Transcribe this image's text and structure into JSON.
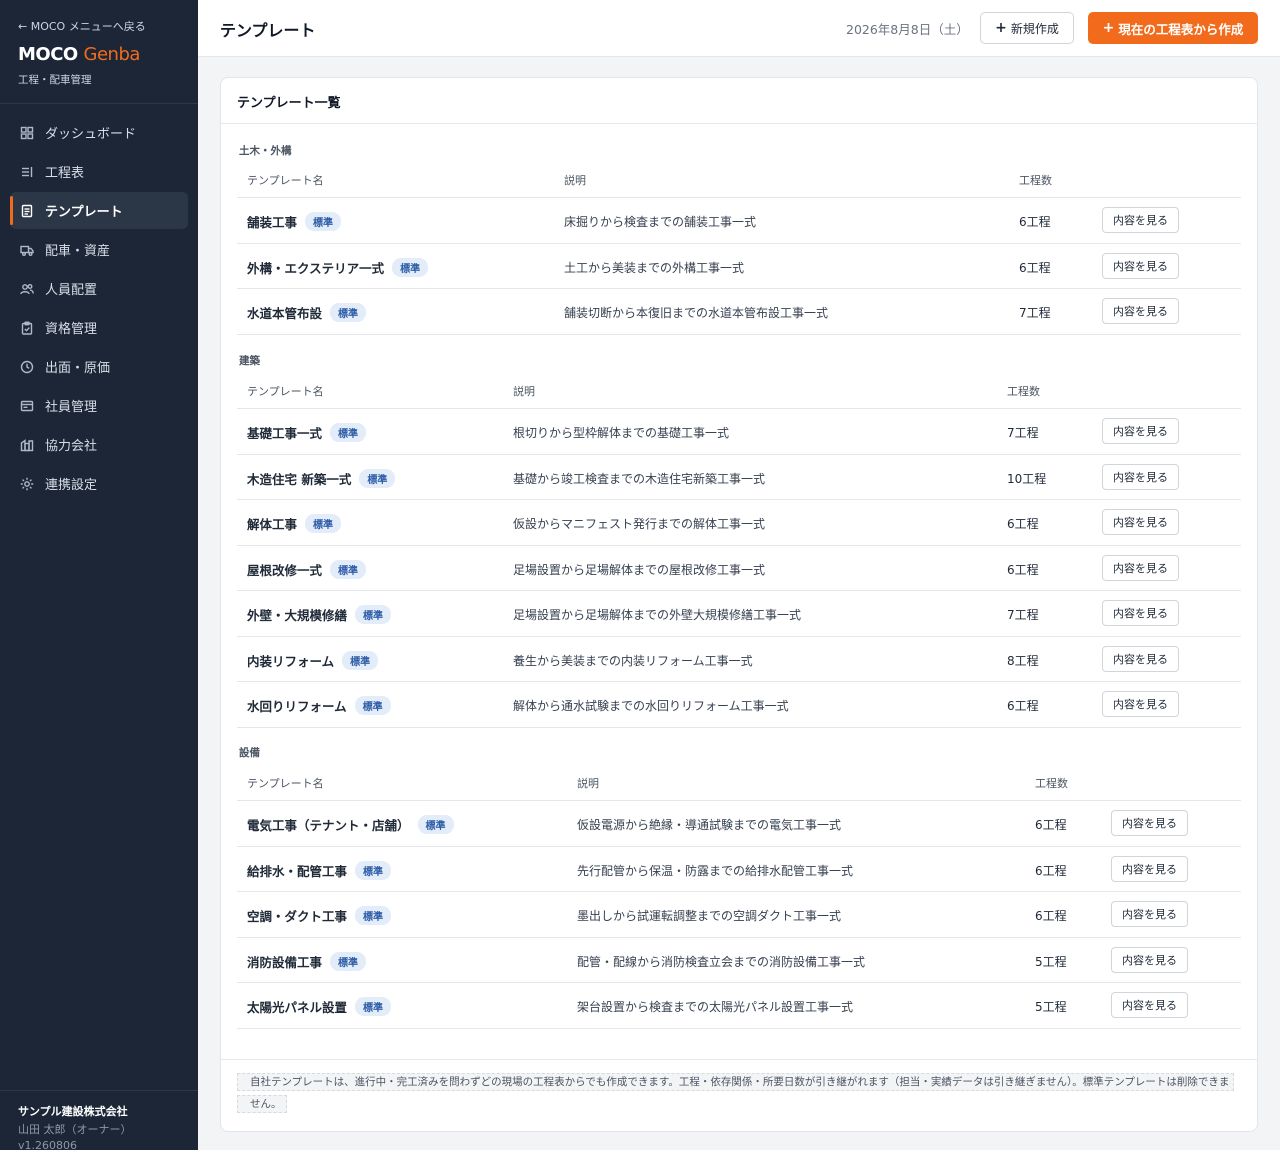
{
  "sidebar": {
    "back_link": "← MOCO メニューへ戻る",
    "brand_main": "MOCO",
    "brand_accent": "Genba",
    "brand_sub": "工程・配車管理",
    "items": [
      {
        "label": "ダッシュボード",
        "icon": "dashboard-icon"
      },
      {
        "label": "工程表",
        "icon": "schedule-icon"
      },
      {
        "label": "テンプレート",
        "icon": "template-icon",
        "active": true
      },
      {
        "label": "配車・資産",
        "icon": "truck-icon"
      },
      {
        "label": "人員配置",
        "icon": "users-icon"
      },
      {
        "label": "資格管理",
        "icon": "clipboard-icon"
      },
      {
        "label": "出面・原価",
        "icon": "clock-icon"
      },
      {
        "label": "社員管理",
        "icon": "id-card-icon"
      },
      {
        "label": "協力会社",
        "icon": "building-icon"
      },
      {
        "label": "連携設定",
        "icon": "gear-icon"
      }
    ],
    "company": "サンプル建設株式会社",
    "user": "山田 太郎（オーナー）",
    "version": "v1.260806"
  },
  "header": {
    "title": "テンプレート",
    "date": "2026年8月8日（土）",
    "new_button": "新規作成",
    "primary_button": "現在の工程表から作成"
  },
  "card": {
    "title": "テンプレート一覧",
    "columns": {
      "name": "テンプレート名",
      "description": "説明",
      "steps": "工程数"
    },
    "badge": "標準",
    "view_button": "内容を見る",
    "sections": [
      {
        "label": "土木・外構",
        "rows": [
          {
            "name": "舗装工事",
            "description": "床掘りから検査までの舗装工事一式",
            "steps": "6工程"
          },
          {
            "name": "外構・エクステリア一式",
            "description": "土工から美装までの外構工事一式",
            "steps": "6工程"
          },
          {
            "name": "水道本管布設",
            "description": "舗装切断から本復旧までの水道本管布設工事一式",
            "steps": "7工程"
          }
        ]
      },
      {
        "label": "建築",
        "rows": [
          {
            "name": "基礎工事一式",
            "description": "根切りから型枠解体までの基礎工事一式",
            "steps": "7工程"
          },
          {
            "name": "木造住宅 新築一式",
            "description": "基礎から竣工検査までの木造住宅新築工事一式",
            "steps": "10工程"
          },
          {
            "name": "解体工事",
            "description": "仮設からマニフェスト発行までの解体工事一式",
            "steps": "6工程"
          },
          {
            "name": "屋根改修一式",
            "description": "足場設置から足場解体までの屋根改修工事一式",
            "steps": "6工程"
          },
          {
            "name": "外壁・大規模修繕",
            "description": "足場設置から足場解体までの外壁大規模修繕工事一式",
            "steps": "7工程"
          },
          {
            "name": "内装リフォーム",
            "description": "養生から美装までの内装リフォーム工事一式",
            "steps": "8工程"
          },
          {
            "name": "水回りリフォーム",
            "description": "解体から通水試験までの水回りリフォーム工事一式",
            "steps": "6工程"
          }
        ]
      },
      {
        "label": "設備",
        "rows": [
          {
            "name": "電気工事（テナント・店舗）",
            "description": "仮設電源から絶縁・導通試験までの電気工事一式",
            "steps": "6工程"
          },
          {
            "name": "給排水・配管工事",
            "description": "先行配管から保温・防露までの給排水配管工事一式",
            "steps": "6工程"
          },
          {
            "name": "空調・ダクト工事",
            "description": "墨出しから試運転調整までの空調ダクト工事一式",
            "steps": "6工程"
          },
          {
            "name": "消防設備工事",
            "description": "配管・配線から消防検査立会までの消防設備工事一式",
            "steps": "5工程"
          },
          {
            "name": "太陽光パネル設置",
            "description": "架台設置から検査までの太陽光パネル設置工事一式",
            "steps": "5工程"
          }
        ]
      }
    ],
    "note": "自社テンプレートは、進行中・完工済みを問わずどの現場の工程表からでも作成できます。工程・依存関係・所要日数が引き継がれます（担当・実績データは引き継ぎません）。標準テンプレートは削除できません。"
  }
}
